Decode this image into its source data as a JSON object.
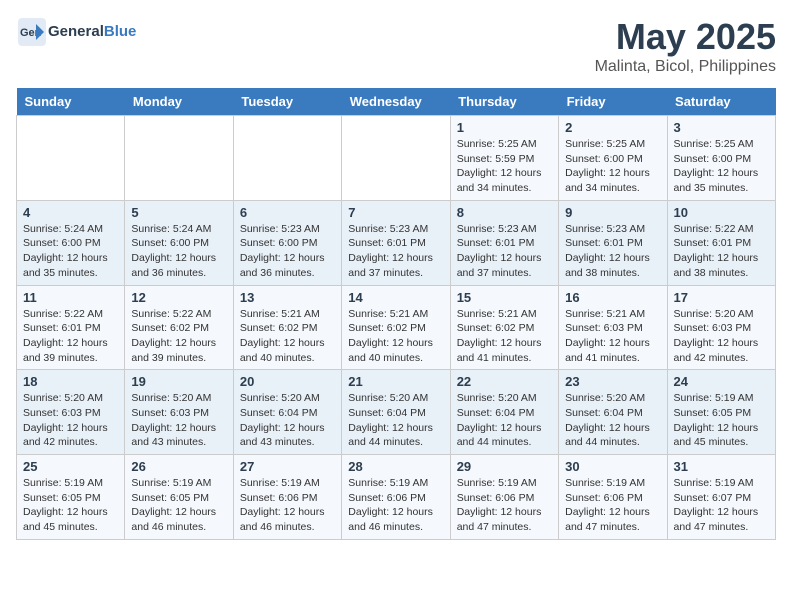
{
  "header": {
    "logo_general": "General",
    "logo_blue": "Blue",
    "title": "May 2025",
    "subtitle": "Malinta, Bicol, Philippines"
  },
  "weekdays": [
    "Sunday",
    "Monday",
    "Tuesday",
    "Wednesday",
    "Thursday",
    "Friday",
    "Saturday"
  ],
  "weeks": [
    [
      {
        "day": "",
        "info": ""
      },
      {
        "day": "",
        "info": ""
      },
      {
        "day": "",
        "info": ""
      },
      {
        "day": "",
        "info": ""
      },
      {
        "day": "1",
        "info": "Sunrise: 5:25 AM\nSunset: 5:59 PM\nDaylight: 12 hours\nand 34 minutes."
      },
      {
        "day": "2",
        "info": "Sunrise: 5:25 AM\nSunset: 6:00 PM\nDaylight: 12 hours\nand 34 minutes."
      },
      {
        "day": "3",
        "info": "Sunrise: 5:25 AM\nSunset: 6:00 PM\nDaylight: 12 hours\nand 35 minutes."
      }
    ],
    [
      {
        "day": "4",
        "info": "Sunrise: 5:24 AM\nSunset: 6:00 PM\nDaylight: 12 hours\nand 35 minutes."
      },
      {
        "day": "5",
        "info": "Sunrise: 5:24 AM\nSunset: 6:00 PM\nDaylight: 12 hours\nand 36 minutes."
      },
      {
        "day": "6",
        "info": "Sunrise: 5:23 AM\nSunset: 6:00 PM\nDaylight: 12 hours\nand 36 minutes."
      },
      {
        "day": "7",
        "info": "Sunrise: 5:23 AM\nSunset: 6:01 PM\nDaylight: 12 hours\nand 37 minutes."
      },
      {
        "day": "8",
        "info": "Sunrise: 5:23 AM\nSunset: 6:01 PM\nDaylight: 12 hours\nand 37 minutes."
      },
      {
        "day": "9",
        "info": "Sunrise: 5:23 AM\nSunset: 6:01 PM\nDaylight: 12 hours\nand 38 minutes."
      },
      {
        "day": "10",
        "info": "Sunrise: 5:22 AM\nSunset: 6:01 PM\nDaylight: 12 hours\nand 38 minutes."
      }
    ],
    [
      {
        "day": "11",
        "info": "Sunrise: 5:22 AM\nSunset: 6:01 PM\nDaylight: 12 hours\nand 39 minutes."
      },
      {
        "day": "12",
        "info": "Sunrise: 5:22 AM\nSunset: 6:02 PM\nDaylight: 12 hours\nand 39 minutes."
      },
      {
        "day": "13",
        "info": "Sunrise: 5:21 AM\nSunset: 6:02 PM\nDaylight: 12 hours\nand 40 minutes."
      },
      {
        "day": "14",
        "info": "Sunrise: 5:21 AM\nSunset: 6:02 PM\nDaylight: 12 hours\nand 40 minutes."
      },
      {
        "day": "15",
        "info": "Sunrise: 5:21 AM\nSunset: 6:02 PM\nDaylight: 12 hours\nand 41 minutes."
      },
      {
        "day": "16",
        "info": "Sunrise: 5:21 AM\nSunset: 6:03 PM\nDaylight: 12 hours\nand 41 minutes."
      },
      {
        "day": "17",
        "info": "Sunrise: 5:20 AM\nSunset: 6:03 PM\nDaylight: 12 hours\nand 42 minutes."
      }
    ],
    [
      {
        "day": "18",
        "info": "Sunrise: 5:20 AM\nSunset: 6:03 PM\nDaylight: 12 hours\nand 42 minutes."
      },
      {
        "day": "19",
        "info": "Sunrise: 5:20 AM\nSunset: 6:03 PM\nDaylight: 12 hours\nand 43 minutes."
      },
      {
        "day": "20",
        "info": "Sunrise: 5:20 AM\nSunset: 6:04 PM\nDaylight: 12 hours\nand 43 minutes."
      },
      {
        "day": "21",
        "info": "Sunrise: 5:20 AM\nSunset: 6:04 PM\nDaylight: 12 hours\nand 44 minutes."
      },
      {
        "day": "22",
        "info": "Sunrise: 5:20 AM\nSunset: 6:04 PM\nDaylight: 12 hours\nand 44 minutes."
      },
      {
        "day": "23",
        "info": "Sunrise: 5:20 AM\nSunset: 6:04 PM\nDaylight: 12 hours\nand 44 minutes."
      },
      {
        "day": "24",
        "info": "Sunrise: 5:19 AM\nSunset: 6:05 PM\nDaylight: 12 hours\nand 45 minutes."
      }
    ],
    [
      {
        "day": "25",
        "info": "Sunrise: 5:19 AM\nSunset: 6:05 PM\nDaylight: 12 hours\nand 45 minutes."
      },
      {
        "day": "26",
        "info": "Sunrise: 5:19 AM\nSunset: 6:05 PM\nDaylight: 12 hours\nand 46 minutes."
      },
      {
        "day": "27",
        "info": "Sunrise: 5:19 AM\nSunset: 6:06 PM\nDaylight: 12 hours\nand 46 minutes."
      },
      {
        "day": "28",
        "info": "Sunrise: 5:19 AM\nSunset: 6:06 PM\nDaylight: 12 hours\nand 46 minutes."
      },
      {
        "day": "29",
        "info": "Sunrise: 5:19 AM\nSunset: 6:06 PM\nDaylight: 12 hours\nand 47 minutes."
      },
      {
        "day": "30",
        "info": "Sunrise: 5:19 AM\nSunset: 6:06 PM\nDaylight: 12 hours\nand 47 minutes."
      },
      {
        "day": "31",
        "info": "Sunrise: 5:19 AM\nSunset: 6:07 PM\nDaylight: 12 hours\nand 47 minutes."
      }
    ]
  ]
}
